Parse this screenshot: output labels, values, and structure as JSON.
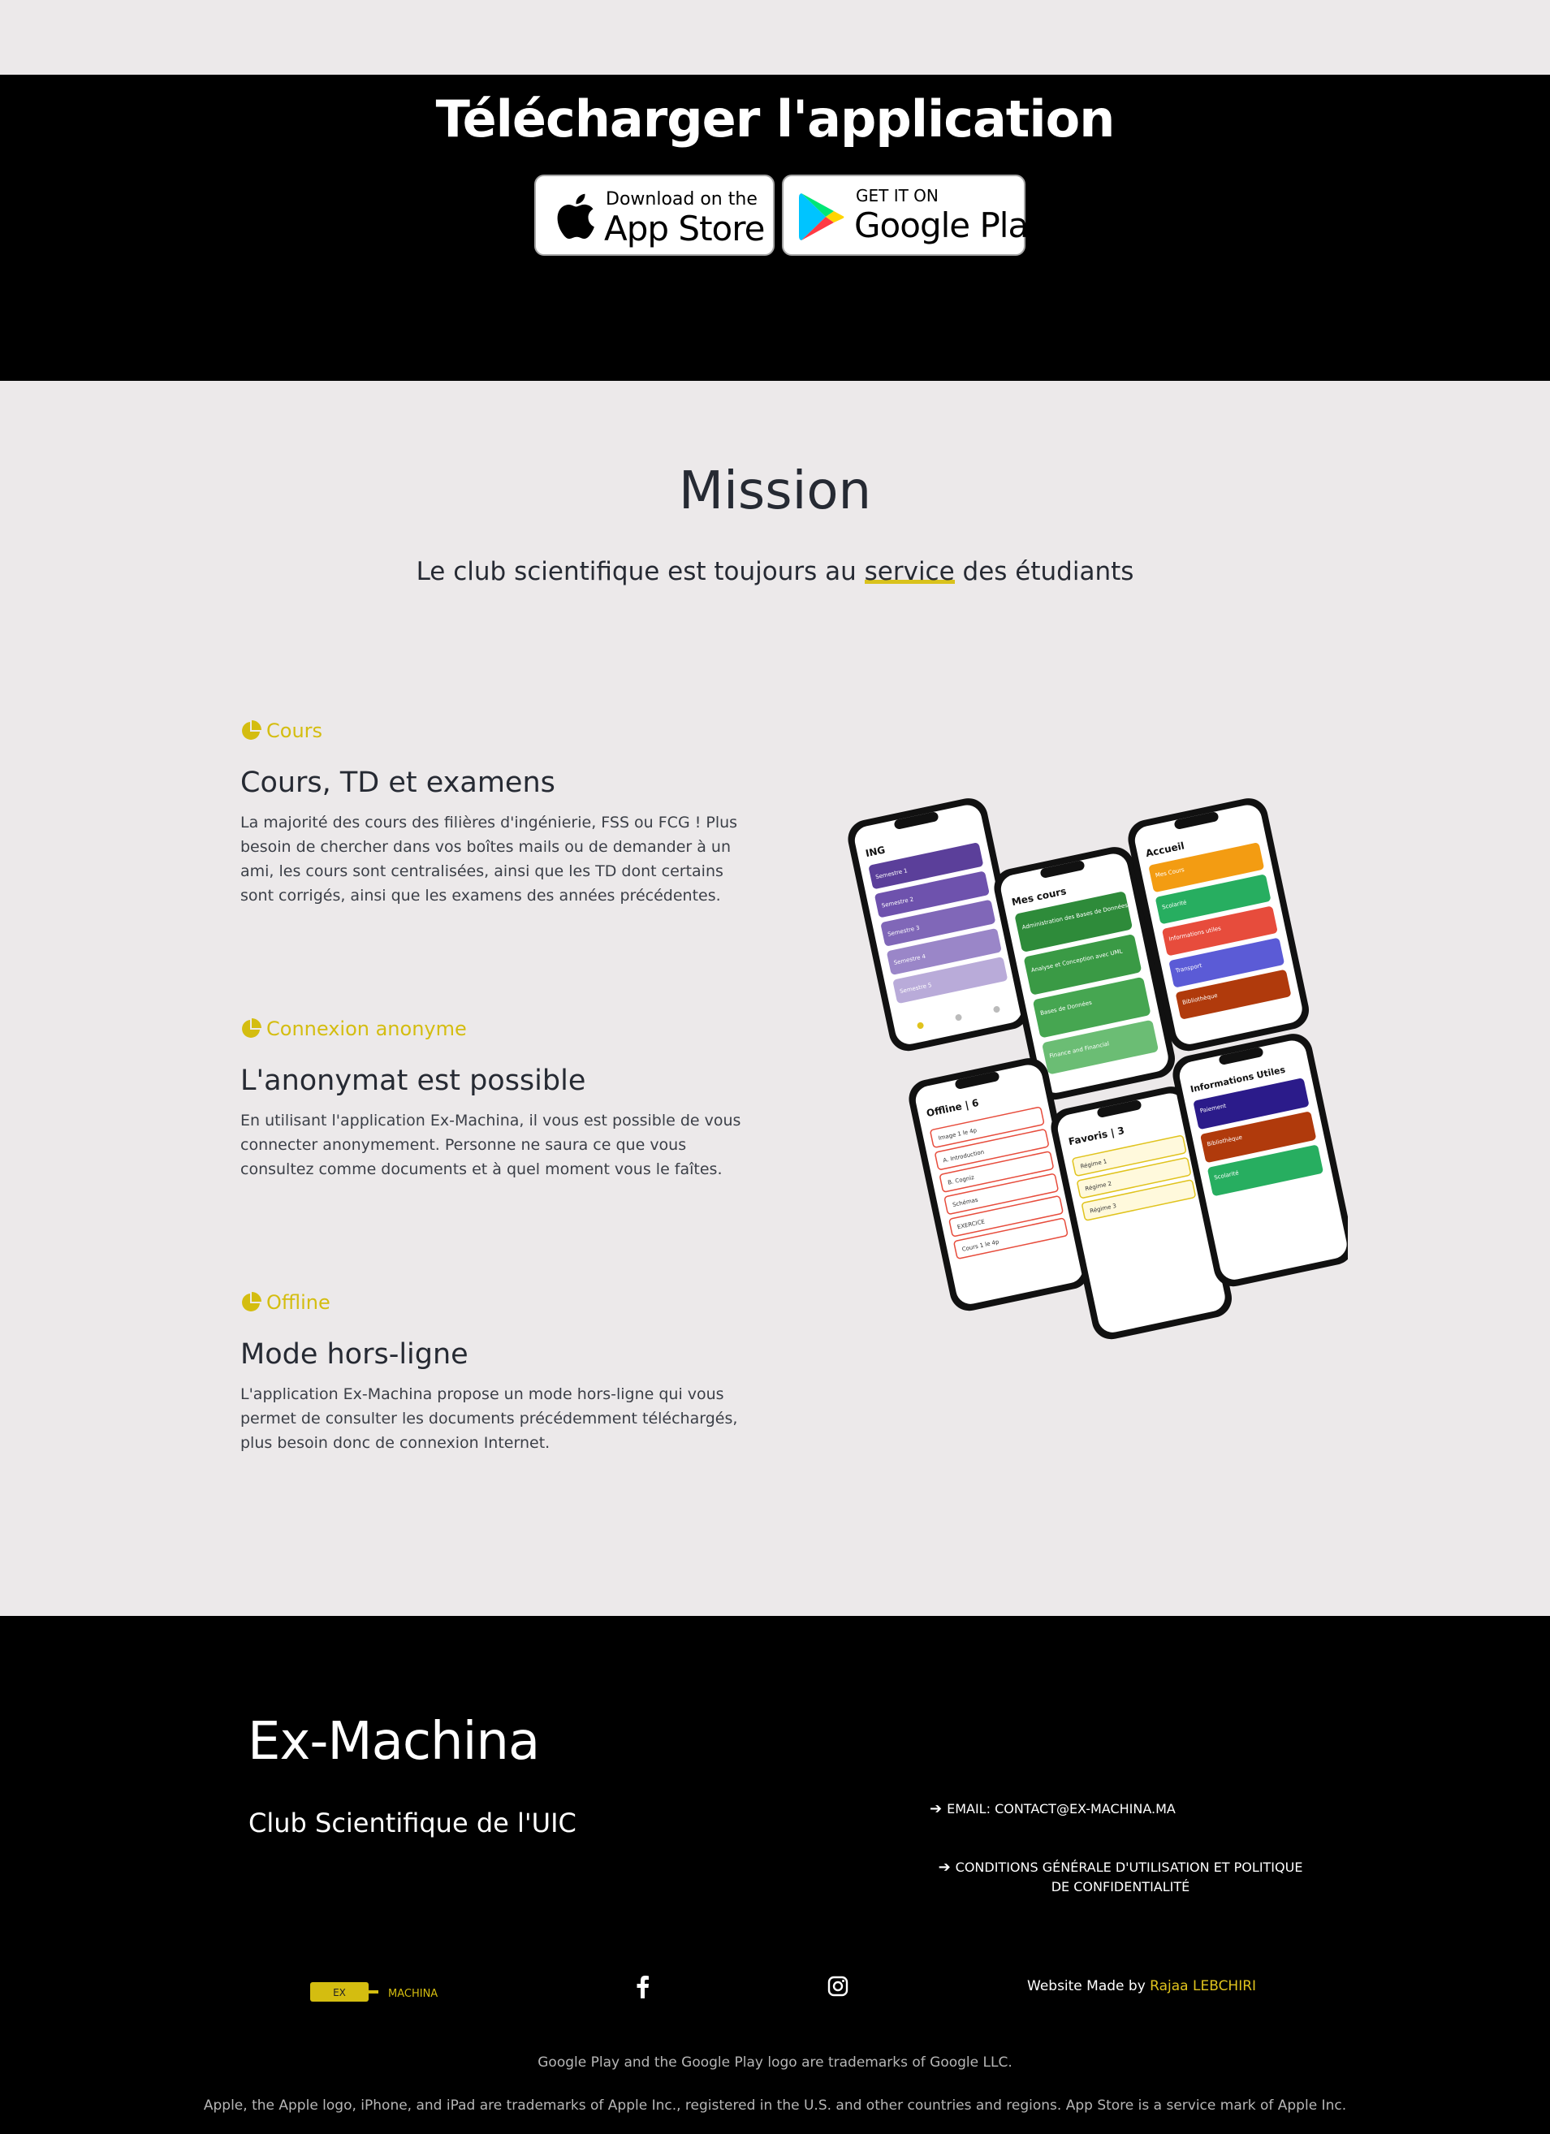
{
  "download": {
    "title": "Télécharger l'application",
    "app_store": {
      "small": "Download on the",
      "big": "App Store"
    },
    "google_play": {
      "small": "GET IT ON",
      "big": "Google Play"
    }
  },
  "mission": {
    "title": "Mission",
    "subtitle_before": "Le club scientifique est toujours au ",
    "subtitle_highlight": "service",
    "subtitle_after": " des étudiants"
  },
  "features": [
    {
      "tag": "Cours",
      "title": "Cours, TD et examens",
      "text": "La majorité des cours des filières d'ingénierie, FSS ou FCG ! Plus besoin de chercher dans vos boîtes mails ou de demander à un ami, les cours sont centralisées, ainsi que les TD dont certains sont corrigés, ainsi que les examens des années précédentes."
    },
    {
      "tag": "Connexion anonyme",
      "title": "L'anonymat est possible",
      "text": "En utilisant l'application Ex-Machina, il vous est possible de vous connecter anonymement. Personne ne saura ce que vous consultez comme documents et à quel moment vous le faîtes."
    },
    {
      "tag": "Offline",
      "title": "Mode hors-ligne",
      "text": "L'application Ex-Machina propose un mode hors-ligne qui vous permet de consulter les documents précédemment téléchargés, plus besoin donc de connexion Internet."
    }
  ],
  "phones": [
    {
      "title": "ING",
      "items": [
        "Semestre 1",
        "Semestre 2",
        "Semestre 3",
        "Semestre 4",
        "Semestre 5"
      ]
    },
    {
      "title": "Mes cours",
      "items": [
        "Administration des Bases de Données",
        "Analyse et Conception avec UML",
        "Bases de Données",
        "Finance and Financial"
      ]
    },
    {
      "title": "Accueil",
      "items": [
        "Mes Cours",
        "Scolarité",
        "Informations utiles",
        "Transport",
        "Bibliothèque"
      ]
    },
    {
      "title": "Offline | 6",
      "items": [
        "Image 1 le 4p",
        "A. Introduction",
        "B. Cogniz",
        "Schémas",
        "EXERCICE",
        "Cours 1 le 4p"
      ]
    },
    {
      "title": "Favoris | 3",
      "items": [
        "Régime 1",
        "Régime 2",
        "Régime 3"
      ]
    },
    {
      "title": "Informations Utiles",
      "items": [
        "Paiement",
        "Bibliothèque",
        "Scolarité"
      ]
    }
  ],
  "footer": {
    "brand": "Ex-Machina",
    "subtitle": "Club Scientifique de l'UIC",
    "email_link": "EMAIL: CONTACT@EX-MACHINA.MA",
    "cgu_link": "CONDITIONS GÉNÉRALE D'UTILISATION ET POLITIQUE DE CONFIDENTIALITÉ",
    "logo_left": "EX",
    "logo_right": "MACHINA",
    "made_by_prefix": "Website Made by ",
    "made_by_name": "Rajaa LEBCHIRI",
    "legal_google": "Google Play and the Google Play logo are trademarks of Google LLC.",
    "legal_apple": "Apple, the Apple logo, iPhone, and iPad are trademarks of Apple Inc., registered in the U.S. and other countries and regions. App Store is a service mark of Apple Inc."
  },
  "colors": {
    "accent": "#d4bd10",
    "dark_text": "#262a33",
    "background": "#ece9ea",
    "band": "#000000"
  },
  "icons": [
    "apple-icon",
    "google-play-icon",
    "pie-chart-icon",
    "arrow-right-icon",
    "facebook-icon",
    "instagram-icon"
  ]
}
